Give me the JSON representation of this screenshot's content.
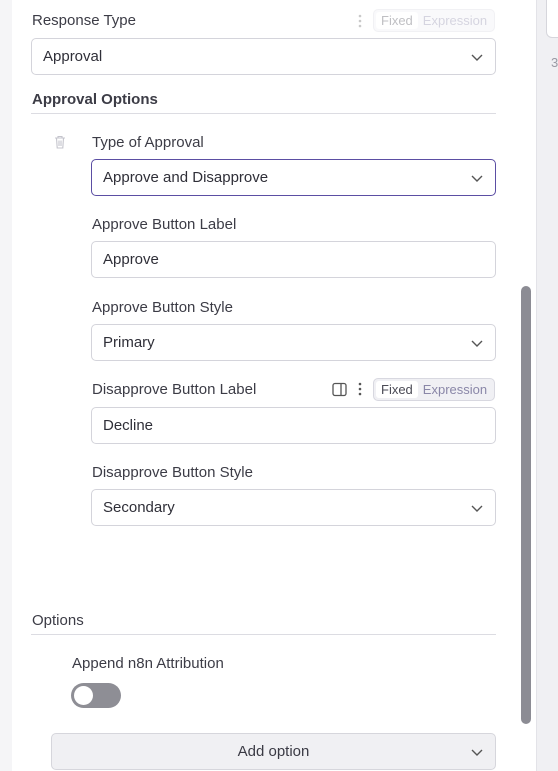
{
  "response_type": {
    "label": "Response Type",
    "value": "Approval",
    "toggle": {
      "fixed": "Fixed",
      "expression": "Expression"
    }
  },
  "approval_options": {
    "title": "Approval Options",
    "type_of_approval": {
      "label": "Type of Approval",
      "value": "Approve and Disapprove"
    },
    "approve_label": {
      "label": "Approve Button Label",
      "value": "Approve"
    },
    "approve_style": {
      "label": "Approve Button Style",
      "value": "Primary"
    },
    "disapprove_label": {
      "label": "Disapprove Button Label",
      "value": "Decline",
      "toggle": {
        "fixed": "Fixed",
        "expression": "Expression"
      }
    },
    "disapprove_style": {
      "label": "Disapprove Button Style",
      "value": "Secondary"
    }
  },
  "options": {
    "title": "Options",
    "append_attribution": {
      "label": "Append n8n Attribution",
      "enabled": false
    },
    "add_option_label": "Add option"
  },
  "edge": {
    "digit": "3"
  },
  "colors": {
    "focus_border": "#5b4ea3",
    "toggle_off": "#8e8e95",
    "scrollbar": "#8c8c94"
  }
}
